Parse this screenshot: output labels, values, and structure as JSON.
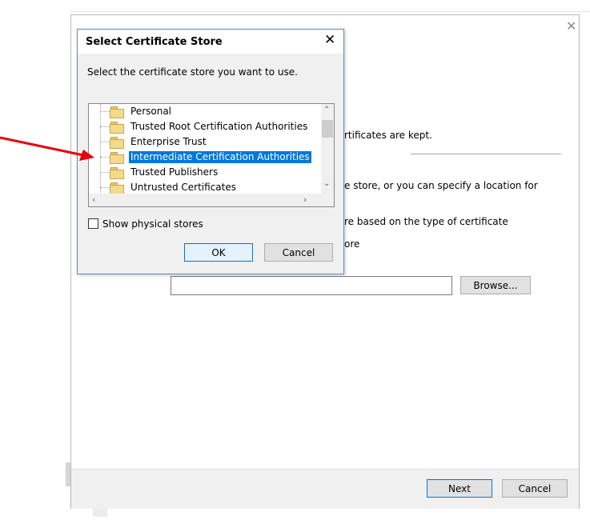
{
  "wizard": {
    "partial_text_1": "rtificates are kept.",
    "partial_text_2": "e store, or you can specify a location for",
    "partial_text_3": "re based on the type of certificate",
    "partial_text_4": "ore",
    "browse_label": "Browse...",
    "next_label": "Next",
    "cancel_label": "Cancel",
    "path_value": ""
  },
  "dialog": {
    "title": "Select Certificate Store",
    "prompt": "Select the certificate store you want to use.",
    "stores": [
      {
        "label": "Personal",
        "selected": false
      },
      {
        "label": "Trusted Root Certification Authorities",
        "selected": false
      },
      {
        "label": "Enterprise Trust",
        "selected": false
      },
      {
        "label": "Intermediate Certification Authorities",
        "selected": true
      },
      {
        "label": "Trusted Publishers",
        "selected": false
      },
      {
        "label": "Untrusted Certificates",
        "selected": false
      }
    ],
    "show_physical_label": "Show physical stores",
    "show_physical_checked": false,
    "ok_label": "OK",
    "cancel_label": "Cancel"
  },
  "colors": {
    "selection": "#0078d7",
    "annotation_arrow": "#e8000b"
  },
  "icons": [
    "close-icon",
    "folder-icon",
    "scroll-up-icon",
    "scroll-down-icon",
    "scroll-left-icon",
    "scroll-right-icon"
  ]
}
